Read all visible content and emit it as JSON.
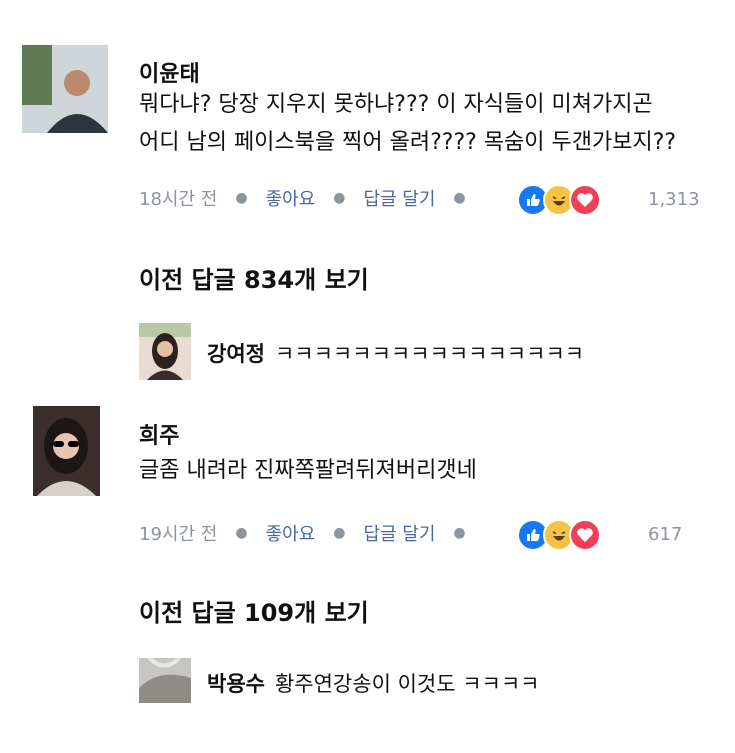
{
  "comments": [
    {
      "author": "이윤태",
      "lines": [
        "뭐다냐? 당장 지우지 못하냐??? 이 자식들이 미쳐가지곤",
        "어디 남의 페이스북을 찍어 올려???? 목숨이 두갠가보지??"
      ],
      "time": "18시간 전",
      "like_label": "좋아요",
      "reply_label": "답글 달기",
      "reaction_count": "1,313",
      "previous_replies": "이전 답글 834개 보기",
      "reply": {
        "author": "강여정",
        "text": "ㅋㅋㅋㅋㅋㅋㅋㅋㅋㅋㅋㅋㅋㅋㅋㅋ"
      }
    },
    {
      "author": "희주",
      "lines": [
        "글좀 내려라 진짜쪽팔려뒤져버리갯네"
      ],
      "time": "19시간 전",
      "like_label": "좋아요",
      "reply_label": "답글 달기",
      "reaction_count": "617",
      "previous_replies": "이전 답글 109개 보기",
      "reply": {
        "author": "박용수",
        "text": "황주연강송이 이것도 ㅋㅋㅋㅋ"
      }
    }
  ],
  "reactions": [
    "like-icon",
    "haha-icon",
    "love-icon"
  ],
  "colors": {
    "link": "#4b67a1",
    "meta": "#8d949e",
    "like": "#1877f2",
    "haha": "#f7c244",
    "love": "#f33e58"
  }
}
